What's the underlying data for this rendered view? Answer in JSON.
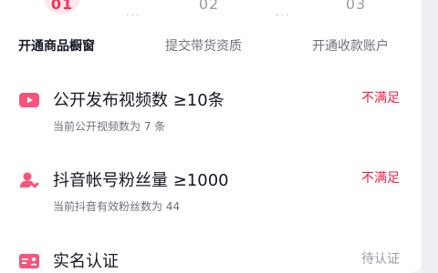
{
  "steps": [
    {
      "number": "01",
      "label": "开通商品橱窗",
      "active": true
    },
    {
      "number": "02",
      "label": "提交带货资质",
      "active": false
    },
    {
      "number": "03",
      "label": "开通收款账户",
      "active": false
    }
  ],
  "requirements": [
    {
      "icon": "video-play-icon",
      "title": "公开发布视频数 ≥10条",
      "subtitle": "当前公开视频数为 7 条",
      "status": "不满足"
    },
    {
      "icon": "user-heart-icon",
      "title": "抖音帐号粉丝量 ≥1000",
      "subtitle": "当前抖音有效粉丝数为 44",
      "status": "不满足"
    },
    {
      "icon": "id-card-icon",
      "title": "实名认证",
      "subtitle": "",
      "status": "待认证"
    }
  ],
  "colors": {
    "accent": "#fe2c55",
    "status_bad": "#e8234b",
    "status_pending": "#9a9aa3",
    "icon_pink": "#f7547c"
  }
}
